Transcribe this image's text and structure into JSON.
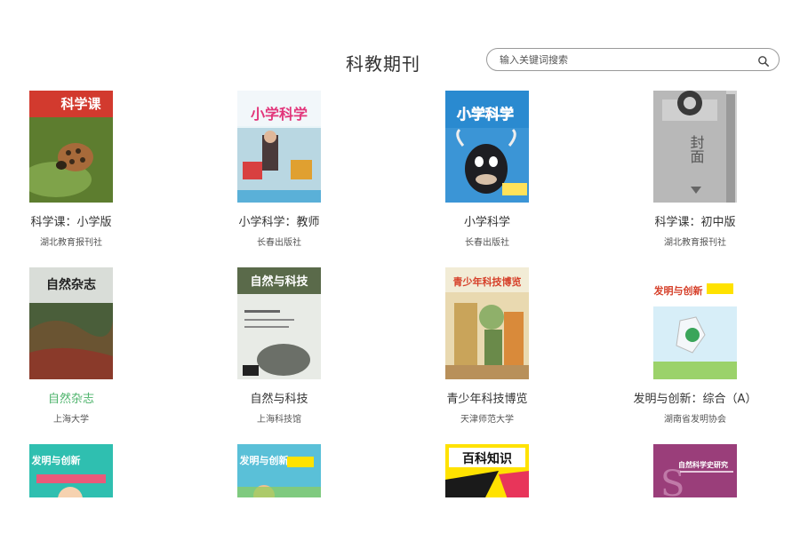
{
  "header": {
    "title": "科教期刊",
    "search_placeholder": "输入关键词搜索"
  },
  "journals": [
    {
      "title": "科学课：小学版",
      "publisher": "湖北教育报刊社",
      "cover_text": "科学课",
      "active": false
    },
    {
      "title": "小学科学：教师",
      "publisher": "长春出版社",
      "cover_text": "小学科学",
      "active": false
    },
    {
      "title": "小学科学",
      "publisher": "长春出版社",
      "cover_text": "小学科学",
      "active": false
    },
    {
      "title": "科学课：初中版",
      "publisher": "湖北教育报刊社",
      "cover_text": "封面",
      "active": false
    },
    {
      "title": "自然杂志",
      "publisher": "上海大学",
      "cover_text": "自然杂志",
      "active": true
    },
    {
      "title": "自然与科技",
      "publisher": "上海科技馆",
      "cover_text": "自然与科技",
      "active": false
    },
    {
      "title": "青少年科技博览",
      "publisher": "天津师范大学",
      "cover_text": "青少年科技博览",
      "active": false
    },
    {
      "title": "发明与创新：综合（A）",
      "publisher": "湖南省发明协会",
      "cover_text": "发明与创新",
      "active": false
    },
    {
      "title": "",
      "publisher": "",
      "cover_text": "发明与创新",
      "active": false
    },
    {
      "title": "",
      "publisher": "",
      "cover_text": "发明与创新",
      "active": false
    },
    {
      "title": "",
      "publisher": "",
      "cover_text": "百科知识",
      "active": false
    },
    {
      "title": "",
      "publisher": "",
      "cover_text": "自然科学史研究",
      "active": false
    }
  ],
  "colors": {
    "active_title": "#4db36b",
    "text": "#333333",
    "border": "#9a9a9a"
  }
}
